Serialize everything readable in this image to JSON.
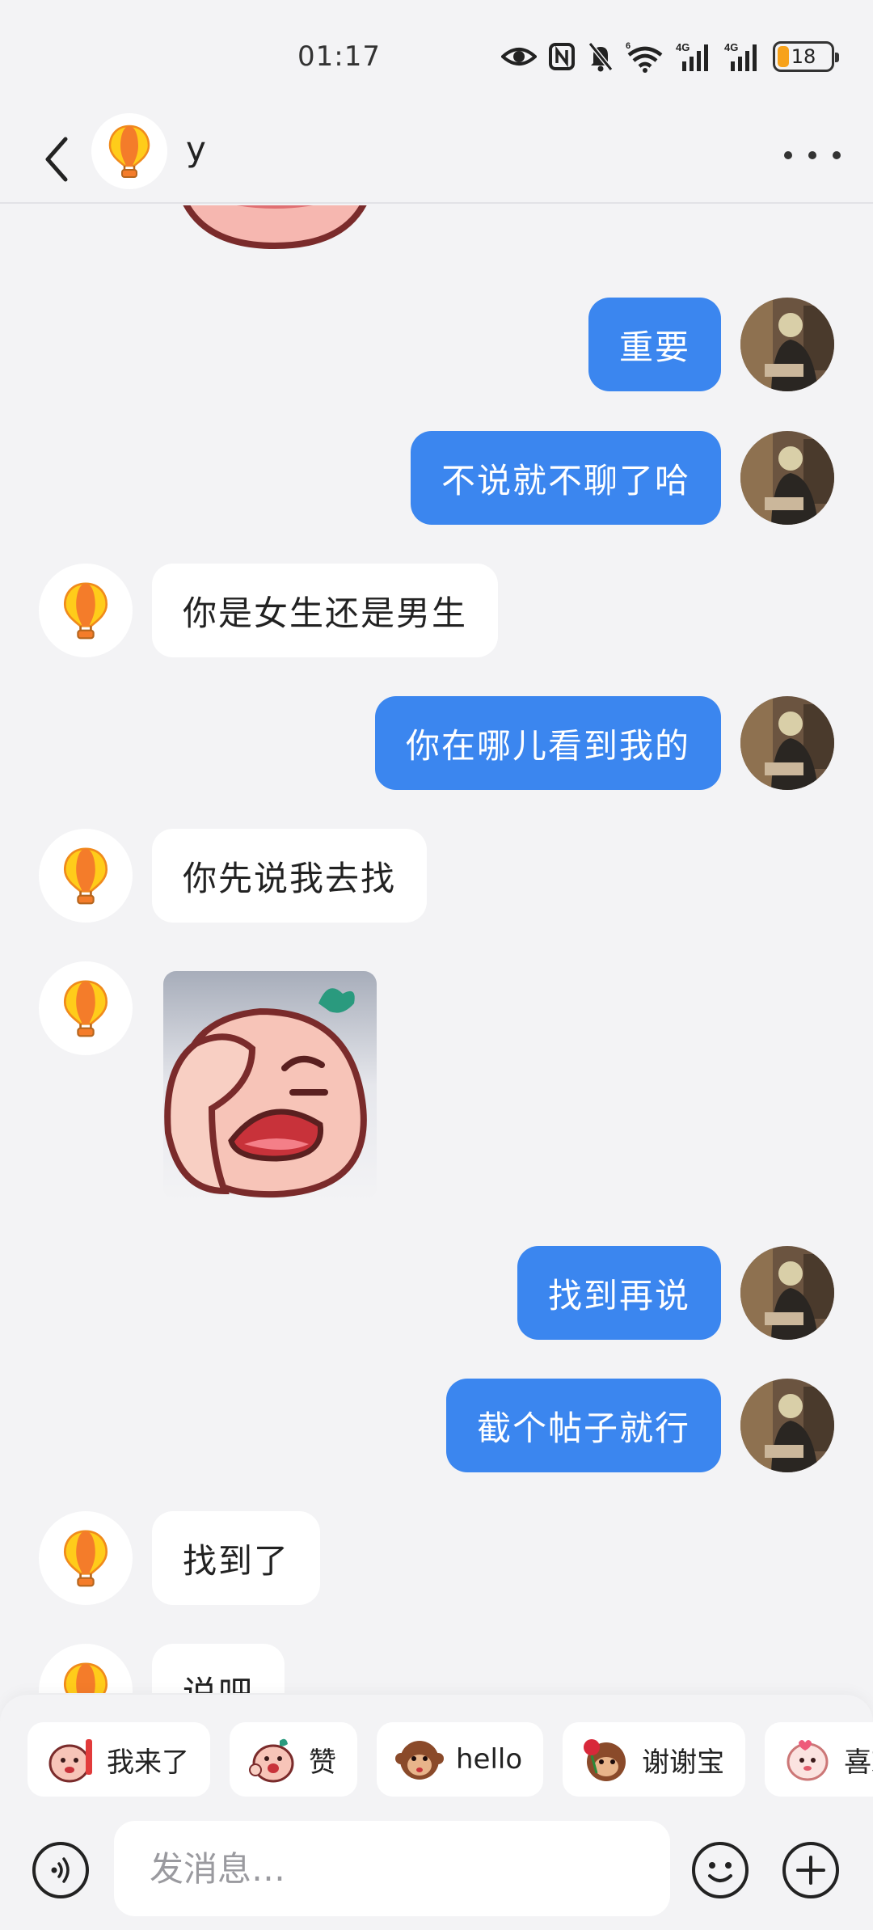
{
  "status_bar": {
    "time": "01:17",
    "battery": "18",
    "icons": [
      "eye-icon",
      "nfc-icon",
      "mute-bell-icon",
      "wifi-6-icon",
      "signal-4g-icon",
      "signal-4g-icon",
      "battery-icon"
    ],
    "accent_battery": "#f7a21b"
  },
  "header": {
    "name": "y",
    "back_icon": "chevron-left-icon",
    "more_icon": "more-horizontal-icon"
  },
  "messages": [
    {
      "side": "out",
      "type": "text",
      "text": "重要"
    },
    {
      "side": "out",
      "type": "text",
      "text": "不说就不聊了哈"
    },
    {
      "side": "in",
      "type": "text",
      "text": "你是女生还是男生"
    },
    {
      "side": "out",
      "type": "text",
      "text": "你在哪儿看到我的"
    },
    {
      "side": "in",
      "type": "text",
      "text": "你先说我去找"
    },
    {
      "side": "in",
      "type": "sticker",
      "sticker": "facepalm-peach-sticker"
    },
    {
      "side": "out",
      "type": "text",
      "text": "找到再说"
    },
    {
      "side": "out",
      "type": "text",
      "text": "截个帖子就行"
    },
    {
      "side": "in",
      "type": "text",
      "text": "找到了"
    },
    {
      "side": "in",
      "type": "text",
      "text": "说吧"
    }
  ],
  "quick_replies": [
    {
      "label": "我来了",
      "icon": "wave-sticker-icon"
    },
    {
      "label": "赞",
      "icon": "thumbs-sticker-icon"
    },
    {
      "label": "hello",
      "icon": "monkey-sticker-icon"
    },
    {
      "label": "谢谢宝",
      "icon": "rose-sticker-icon"
    },
    {
      "label": "喜欢",
      "icon": "love-sticker-icon"
    }
  ],
  "input": {
    "placeholder": "发消息…"
  },
  "colors": {
    "outgoing_bubble": "#3b86ef",
    "incoming_bubble": "#ffffff",
    "background": "#f3f3f5"
  }
}
